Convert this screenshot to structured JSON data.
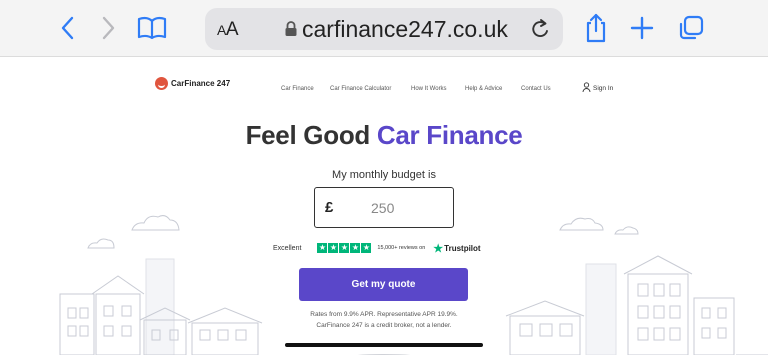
{
  "browser": {
    "text_size_label_small": "A",
    "text_size_label_large": "A",
    "url": "carfinance247.co.uk"
  },
  "site": {
    "logo_text": "CarFinance 247",
    "nav": [
      "Car Finance",
      "Car Finance Calculator",
      "How It Works",
      "Help & Advice",
      "Contact Us"
    ],
    "sign_in": "Sign In"
  },
  "hero": {
    "headline_main": "Feel Good ",
    "headline_accent": "Car Finance",
    "budget_label": "My monthly budget is",
    "currency": "£",
    "budget_value": "250"
  },
  "trustpilot": {
    "rating_label": "Excellent",
    "reviews": "15,000+ reviews on",
    "brand": "Trustpilot"
  },
  "cta": {
    "label": "Get my quote"
  },
  "legal": {
    "line1": "Rates from 9.9% APR. Representative APR 19.9%.",
    "line2": "CarFinance 247 is a credit broker, not a lender."
  },
  "colors": {
    "accent": "#5a47c9",
    "brand_red": "#e0553e",
    "trustpilot_green": "#00b67a"
  },
  "icons": [
    "back-icon",
    "forward-icon",
    "bookmarks-icon",
    "lock-icon",
    "reload-icon",
    "share-icon",
    "new-tab-icon",
    "tabs-icon",
    "user-icon",
    "trustpilot-star-icon"
  ]
}
